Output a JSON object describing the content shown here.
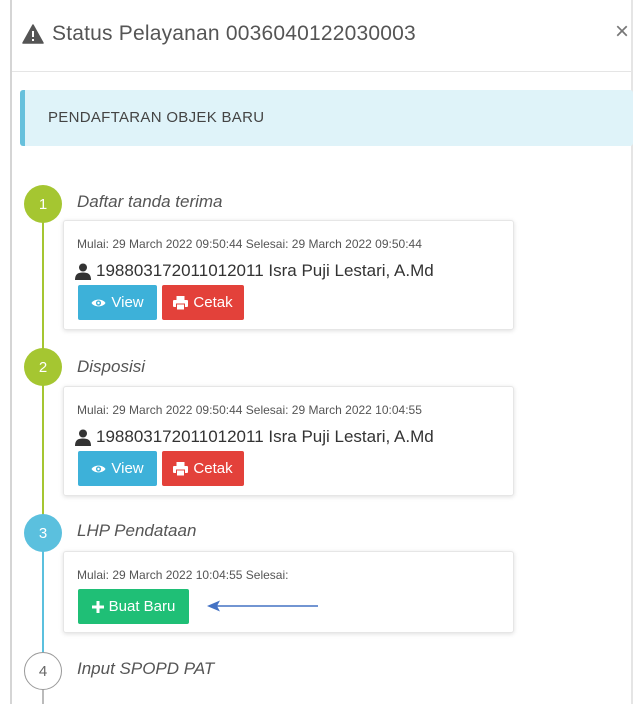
{
  "modal": {
    "title": "Status Pelayanan 0036040122030003",
    "close": "×"
  },
  "callout": {
    "text": "PENDAFTARAN OBJEK BARU"
  },
  "steps": [
    {
      "number": "1",
      "title": "Daftar tanda terima",
      "meta": "Mulai: 29 March 2022 09:50:44 Selesai: 29 March 2022 09:50:44",
      "user": "198803172011012011 Isra Puji Lestari, A.Md",
      "view_label": "View",
      "cetak_label": "Cetak"
    },
    {
      "number": "2",
      "title": "Disposisi",
      "meta": "Mulai: 29 March 2022 09:50:44 Selesai: 29 March 2022 10:04:55",
      "user": "198803172011012011 Isra Puji Lestari, A.Md",
      "view_label": "View",
      "cetak_label": "Cetak"
    },
    {
      "number": "3",
      "title": "LHP Pendataan",
      "meta": "Mulai: 29 March 2022 10:04:55 Selesai:",
      "buat_label": "Buat Baru"
    },
    {
      "number": "4",
      "title": "Input SPOPD PAT"
    }
  ],
  "colors": {
    "done": "#a5c631",
    "current": "#5bc0de",
    "view_button": "#3db1d9",
    "cetak_button": "#e3413a",
    "buat_button": "#1fbf76",
    "annotation_arrow": "#4472c4"
  },
  "icons": {
    "header": "warning-icon",
    "user": "user-icon",
    "view": "eye-icon",
    "cetak": "print-icon",
    "buat": "plus-icon"
  }
}
